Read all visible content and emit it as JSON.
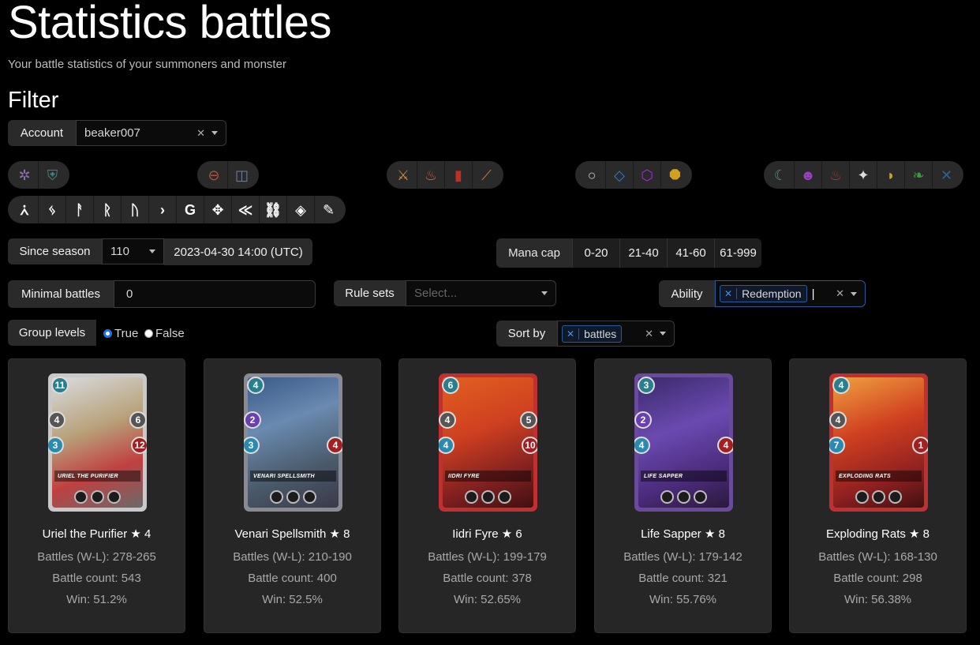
{
  "page": {
    "title": "Statistics battles",
    "subtitle": "Your battle statistics of your summoners and monster",
    "filter_heading": "Filter"
  },
  "account": {
    "label": "Account",
    "value": "beaker007"
  },
  "icon_groups": {
    "group1": [
      {
        "name": "neutral-icon",
        "glyph": "✲",
        "color": "#8a6fb0"
      },
      {
        "name": "shield-icon",
        "glyph": "⛨",
        "color": "#3a8a8a"
      }
    ],
    "group2": [
      {
        "name": "no-zero-icon",
        "glyph": "⊖",
        "color": "#b05040"
      },
      {
        "name": "tank-icon",
        "glyph": "◫",
        "color": "#7080a0"
      }
    ],
    "group3": [
      {
        "name": "sword-icon",
        "glyph": "⚔",
        "color": "#d08a40"
      },
      {
        "name": "cake-icon",
        "glyph": "♨",
        "color": "#d06040"
      },
      {
        "name": "banner-icon",
        "glyph": "▮",
        "color": "#c03020"
      },
      {
        "name": "blade-icon",
        "glyph": "⟋",
        "color": "#e07a20"
      }
    ],
    "group4": [
      {
        "name": "circle-icon",
        "glyph": "○",
        "color": "#cccccc"
      },
      {
        "name": "diamond-icon",
        "glyph": "◇",
        "color": "#2a80d0"
      },
      {
        "name": "hexagon-icon",
        "glyph": "⬡",
        "color": "#a030d0"
      },
      {
        "name": "octagon-icon",
        "glyph": "⯃",
        "color": "#d0a020"
      }
    ],
    "group5": [
      {
        "name": "water-icon",
        "glyph": "☾",
        "color": "#3a9a9a"
      },
      {
        "name": "death-icon",
        "glyph": "☻",
        "color": "#9a40c0"
      },
      {
        "name": "fire-icon",
        "glyph": "♨",
        "color": "#b03030"
      },
      {
        "name": "life-icon",
        "glyph": "✦",
        "color": "#dddddd"
      },
      {
        "name": "earth-icon",
        "glyph": "◗",
        "color": "#d0a020"
      },
      {
        "name": "dragon-icon",
        "glyph": "❧",
        "color": "#3a9a40"
      },
      {
        "name": "gold-icon",
        "glyph": "✕",
        "color": "#3060a0"
      }
    ]
  },
  "rule_icons": [
    {
      "name": "arrow-a-icon",
      "glyph": "⩑"
    },
    {
      "name": "bolt-icon",
      "glyph": "ᛃ"
    },
    {
      "name": "flag-icon",
      "glyph": "ᚨ"
    },
    {
      "name": "rune-r-icon",
      "glyph": "ᚱ"
    },
    {
      "name": "rune-u-icon",
      "glyph": "ᚢ"
    },
    {
      "name": "chevron-right-icon",
      "glyph": "›"
    },
    {
      "name": "rune-g-icon",
      "glyph": "G"
    },
    {
      "name": "cross-arrows-icon",
      "glyph": "✥"
    },
    {
      "name": "double-chevron-icon",
      "glyph": "≪"
    },
    {
      "name": "chain-icon",
      "glyph": "⛓"
    },
    {
      "name": "diamond-shield-icon",
      "glyph": "◈"
    },
    {
      "name": "scroll-icon",
      "glyph": "✎"
    }
  ],
  "season": {
    "label": "Since season",
    "value": "110",
    "date": "2023-04-30 14:00 (UTC)"
  },
  "mana_cap": {
    "label": "Mana cap",
    "options": [
      "0-20",
      "21-40",
      "41-60",
      "61-999"
    ]
  },
  "minimal_battles": {
    "label": "Minimal battles",
    "value": "0"
  },
  "rule_sets": {
    "label": "Rule sets",
    "placeholder": "Select..."
  },
  "ability": {
    "label": "Ability",
    "tag": "Redemption"
  },
  "group_levels": {
    "label": "Group levels",
    "true_label": "True",
    "false_label": "False"
  },
  "sort_by": {
    "label": "Sort by",
    "tag": "battles"
  },
  "cards": [
    {
      "name": "Uriel the Purifier ★ 4",
      "battles": "Battles (W-L): 278-265",
      "count": "Battle count: 543",
      "win": "Win: 51.2%",
      "banner": "URIEL THE PURIFIER",
      "mana": "11",
      "atk": "4",
      "spd": "3",
      "hp": "12",
      "armor": "6",
      "bg": "linear-gradient(160deg,#d9dbe0 0%,#b8a27a 40%,#c04040 70%,#6a6a6a 100%)",
      "frame": "#c9c9c9"
    },
    {
      "name": "Venari Spellsmith ★ 8",
      "battles": "Battles (W-L): 210-190",
      "count": "Battle count: 400",
      "win": "Win: 52.5%",
      "banner": "VENARI SPELLSMITH",
      "mana": "4",
      "atk": "2",
      "spd": "3",
      "hp": "4",
      "armor": "",
      "bg": "linear-gradient(160deg,#3a5a8a 0%,#6a8ab0 35%,#4a5a6a 70%,#3a3a4a 100%)",
      "frame": "#8a8a95"
    },
    {
      "name": "Iidri Fyre ★ 6",
      "battles": "Battles (W-L): 199-179",
      "count": "Battle count: 378",
      "win": "Win: 52.65%",
      "banner": "IIDRI FYRE",
      "mana": "6",
      "atk": "4",
      "spd": "4",
      "hp": "10",
      "armor": "5",
      "bg": "linear-gradient(160deg,#e06020 0%,#d04020 40%,#802020 75%,#401010 100%)",
      "frame": "#c03030"
    },
    {
      "name": "Life Sapper ★ 8",
      "battles": "Battles (W-L): 179-142",
      "count": "Battle count: 321",
      "win": "Win: 55.76%",
      "banner": "LIFE SAPPER",
      "mana": "3",
      "atk": "2",
      "spd": "4",
      "hp": "4",
      "armor": "",
      "bg": "linear-gradient(160deg,#3a2a6a 0%,#6a4ab0 40%,#4a2a7a 75%,#2a1a3a 100%)",
      "frame": "#6a4a9a"
    },
    {
      "name": "Exploding Rats ★ 8",
      "battles": "Battles (W-L): 168-130",
      "count": "Battle count: 298",
      "win": "Win: 56.38%",
      "banner": "EXPLODING RATS",
      "mana": "4",
      "atk": "4",
      "spd": "7",
      "hp": "1",
      "armor": "",
      "bg": "linear-gradient(160deg,#f0a040 0%,#d04020 40%,#902020 75%,#401010 100%)",
      "frame": "#c03030"
    }
  ]
}
